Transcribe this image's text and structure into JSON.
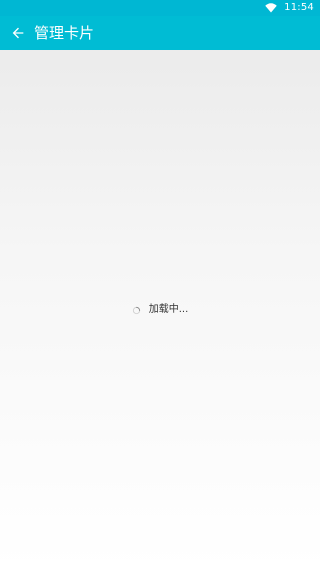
{
  "status_bar": {
    "time": "11:54",
    "wifi_icon": "wifi-icon",
    "background": "#00b7d3"
  },
  "app_bar": {
    "title": "管理卡片",
    "back_icon": "arrow-left-icon",
    "background": "#00bcd4",
    "text_color": "#ffffff"
  },
  "content": {
    "loading_text": "加载中...",
    "spinner_icon": "loading-spinner-icon"
  }
}
